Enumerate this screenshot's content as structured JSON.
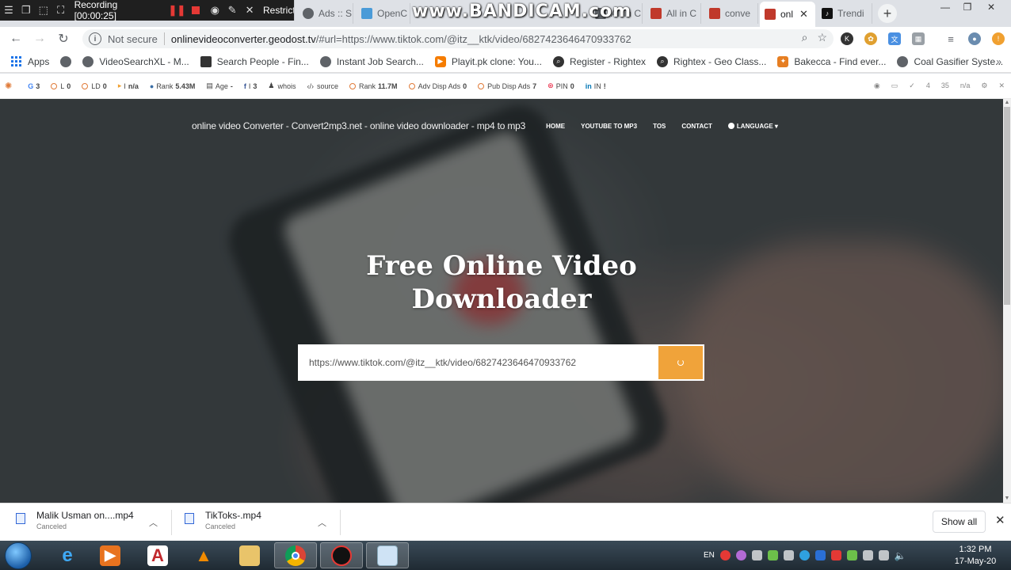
{
  "recorder": {
    "status": "Recording [00:00:25]"
  },
  "watermark": "www.BANDICAM.com",
  "tabs": [
    {
      "label": "Restrict",
      "color": "#ffffff"
    },
    {
      "label": "Ads :: S",
      "color": "#5f6368"
    },
    {
      "label": "OpenC",
      "color": "#4a9bd8"
    },
    {
      "label": "All in C",
      "color": "#5f6368"
    },
    {
      "label": "All in C",
      "color": "#c0392b"
    },
    {
      "label": "conve",
      "color": "#c0392b"
    },
    {
      "label": "onl",
      "color": "#c0392b",
      "active": true
    },
    {
      "label": "Trendi",
      "color": "#111111"
    }
  ],
  "address": {
    "security": "Not secure",
    "host": "onlinevideoconverter.geodost.tv",
    "path": "/#url=https://www.tiktok.com/@itz__ktk/video/6827423646470933762"
  },
  "bookmarks": [
    {
      "label": "Apps",
      "icon": "apps-grid"
    },
    {
      "label": "",
      "icon": "globe"
    },
    {
      "label": "VideoSearchXL - M...",
      "icon": "globe"
    },
    {
      "label": "Search People - Fin...",
      "icon": "person"
    },
    {
      "label": "Instant Job Search...",
      "icon": "globe"
    },
    {
      "label": "Playit.pk clone: You...",
      "icon": "play"
    },
    {
      "label": "Register - Rightex",
      "icon": "search"
    },
    {
      "label": "Rightex - Geo Class...",
      "icon": "search"
    },
    {
      "label": "Bakecca - Find ever...",
      "icon": "star"
    },
    {
      "label": "Coal Gasifier Syste...",
      "icon": "globe"
    }
  ],
  "seo": [
    {
      "label": "G",
      "value": "3"
    },
    {
      "label": "L",
      "value": "0"
    },
    {
      "label": "LD",
      "value": "0"
    },
    {
      "label": "I",
      "value": "n/a"
    },
    {
      "label": "Rank",
      "value": "5.43M"
    },
    {
      "label": "Age",
      "value": "-"
    },
    {
      "label": "I",
      "value": "3"
    },
    {
      "label": "whois",
      "value": ""
    },
    {
      "label": "source",
      "value": ""
    },
    {
      "label": "Rank",
      "value": "11.7M"
    },
    {
      "label": "Adv Disp Ads",
      "value": "0"
    },
    {
      "label": "Pub Disp Ads",
      "value": "7"
    },
    {
      "label": "PIN",
      "value": "0"
    },
    {
      "label": "IN",
      "value": "!"
    }
  ],
  "seo_right": [
    "4",
    "35",
    "n/a"
  ],
  "site": {
    "brand": "online video Converter - Convert2mp3.net - online video downloader - mp4 to mp3",
    "nav": [
      "HOME",
      "YOUTUBE TO MP3",
      "TOS",
      "CONTACT",
      "LANGUAGE"
    ],
    "headline_line1": "Free Online Video",
    "headline_line2": "Downloader",
    "search_value": "https://www.tiktok.com/@itz__ktk/video/6827423646470933762"
  },
  "downloads": [
    {
      "name": "Malik Usman  on....mp4",
      "status": "Canceled"
    },
    {
      "name": "TikToks-.mp4",
      "status": "Canceled"
    }
  ],
  "shelf": {
    "show_all": "Show all"
  },
  "taskbar": {
    "lang": "EN",
    "time": "1:32 PM",
    "date": "17-May-20"
  }
}
